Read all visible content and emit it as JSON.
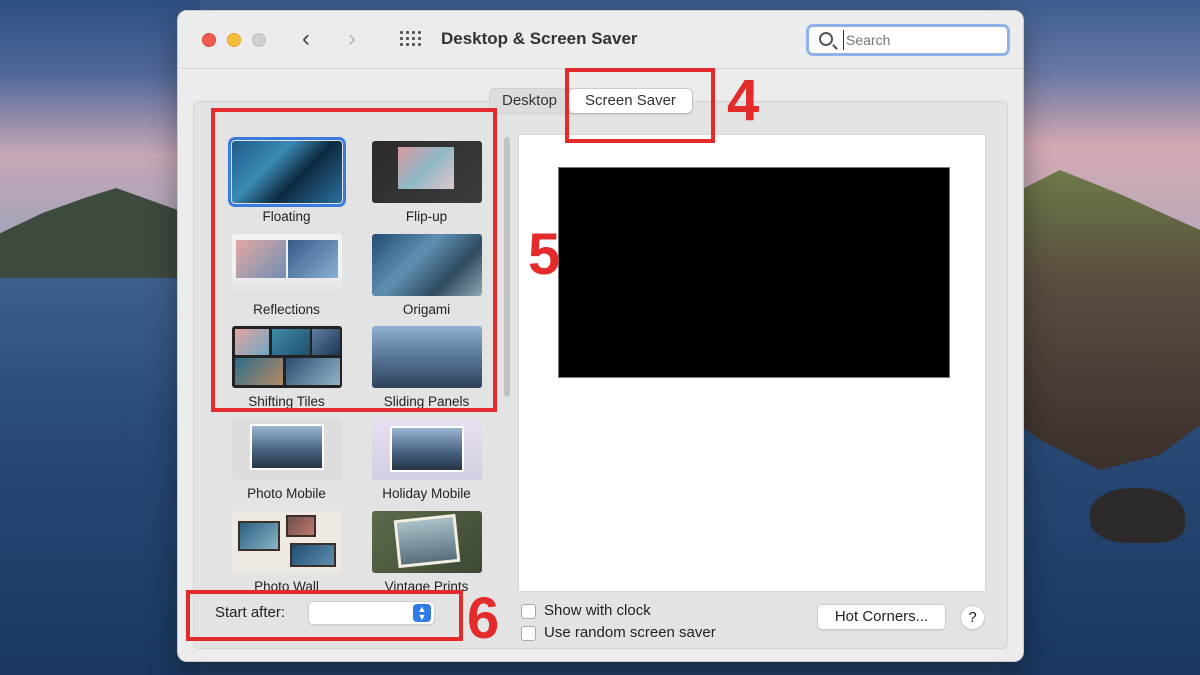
{
  "window": {
    "title": "Desktop & Screen Saver",
    "search_placeholder": "Search"
  },
  "tabs": [
    {
      "label": "Desktop",
      "active": false
    },
    {
      "label": "Screen Saver",
      "active": true
    }
  ],
  "savers": [
    {
      "label": "Floating",
      "selected": true
    },
    {
      "label": "Flip-up",
      "selected": false
    },
    {
      "label": "Reflections",
      "selected": false
    },
    {
      "label": "Origami",
      "selected": false
    },
    {
      "label": "Shifting Tiles",
      "selected": false
    },
    {
      "label": "Sliding Panels",
      "selected": false
    },
    {
      "label": "Photo Mobile",
      "selected": false
    },
    {
      "label": "Holiday Mobile",
      "selected": false
    },
    {
      "label": "Photo Wall",
      "selected": false
    },
    {
      "label": "Vintage Prints",
      "selected": false
    }
  ],
  "controls": {
    "start_after_label": "Start after:",
    "start_after_value": "",
    "show_clock_label": "Show with clock",
    "show_clock_checked": false,
    "random_label": "Use random screen saver",
    "random_checked": false,
    "hot_corners_label": "Hot Corners...",
    "help_label": "?"
  },
  "annotations": {
    "tab_number": "4",
    "list_number": "5",
    "start_number": "6",
    "color": "#e42b2b"
  },
  "colors": {
    "accent": "#3a7be0",
    "close": "#ee5a52",
    "minimize": "#f6bd3b"
  }
}
